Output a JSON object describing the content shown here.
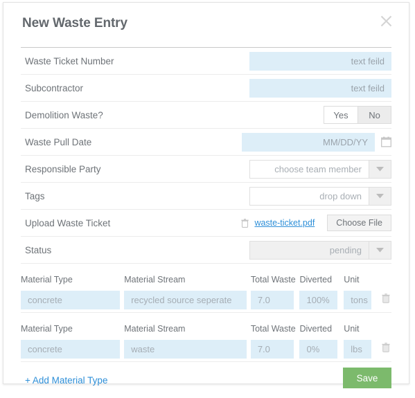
{
  "modal": {
    "title": "New Waste Entry",
    "close_icon": "close-icon"
  },
  "fields": {
    "waste_ticket_number": {
      "label": "Waste Ticket Number",
      "placeholder": "text feild"
    },
    "subcontractor": {
      "label": "Subcontractor",
      "placeholder": "text feild"
    },
    "demolition_waste": {
      "label": "Demolition Waste?",
      "yes": "Yes",
      "no": "No",
      "selected": "No"
    },
    "waste_pull_date": {
      "label": "Waste Pull Date",
      "placeholder": "MM/DD/YY",
      "icon": "calendar-icon"
    },
    "responsible_party": {
      "label": "Responsible Party",
      "value": "choose team member",
      "arrow": "chevron-down-icon"
    },
    "tags": {
      "label": "Tags",
      "value": "drop down",
      "arrow": "chevron-down-icon"
    },
    "upload_waste_ticket": {
      "label": "Upload Waste Ticket",
      "trash_icon": "trash-icon",
      "file_name": "waste-ticket.pdf",
      "button": "Choose File"
    },
    "status": {
      "label": "Status",
      "value": "pending",
      "arrow": "chevron-down-icon"
    }
  },
  "materials": {
    "headers": [
      "Material Type",
      "Material Stream",
      "Total Waste",
      "Diverted",
      "Unit"
    ],
    "rows": [
      {
        "material_type": "concrete",
        "material_stream": "recycled source seperate",
        "total_waste": "7.0",
        "diverted": "100%",
        "unit": "tons",
        "delete_icon": "trash-icon"
      },
      {
        "material_type": "concrete",
        "material_stream": "waste",
        "total_waste": "7.0",
        "diverted": "0%",
        "unit": "lbs",
        "delete_icon": "trash-icon"
      }
    ]
  },
  "footer": {
    "add_link": "+ Add Material Type",
    "save_label": "Save"
  },
  "colors": {
    "field_blue": "#ddeef8",
    "link_blue": "#2e8fd8",
    "save_green": "#7cba6c",
    "label_gray": "#6e7378",
    "placeholder_gray": "#a5adb4"
  }
}
